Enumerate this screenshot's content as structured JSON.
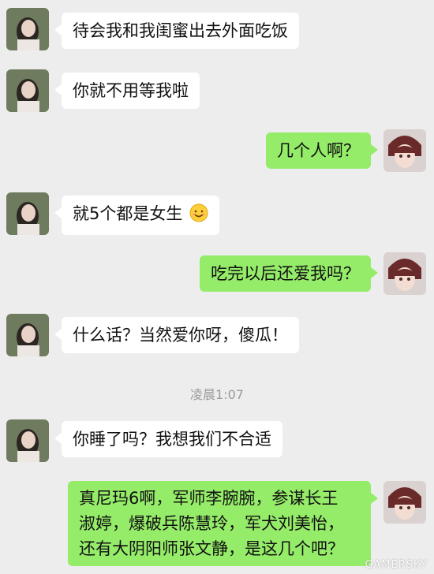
{
  "messages": [
    {
      "sender": "girl",
      "text": "待会我和我闺蜜出去外面吃饭"
    },
    {
      "sender": "girl",
      "text": "你就不用等我啦"
    },
    {
      "sender": "boy",
      "text": "几个人啊？"
    },
    {
      "sender": "girl",
      "text": "就5个都是女生",
      "emoji_icon": "smile-emoji-icon"
    },
    {
      "sender": "boy",
      "text": "吃完以后还爱我吗？"
    },
    {
      "sender": "girl",
      "text": "什么话？当然爱你呀，傻瓜！"
    },
    {
      "sender": "girl",
      "text": "你睡了吗？我想我们不合适"
    },
    {
      "sender": "boy",
      "lines": [
        "真尼玛6啊，军师李腕腕，参谋长王",
        "淑婷，爆破兵陈慧玲，军犬刘美怡，",
        "还有大阴阳师张文静，是这几个吧？"
      ]
    }
  ],
  "timestamp": "凌晨1:07",
  "watermark": "GAMERSKY",
  "colors": {
    "background": "#ededed",
    "sent_bubble": "#95ec69",
    "received_bubble": "#ffffff"
  }
}
